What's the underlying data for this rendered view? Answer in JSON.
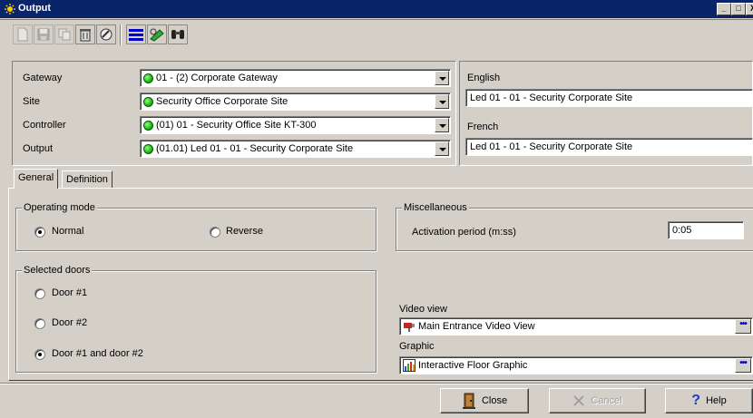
{
  "window": {
    "title": "Output",
    "controls": [
      "_",
      "□",
      "X"
    ]
  },
  "toolbar": {
    "buttons": [
      {
        "icon": "new-icon",
        "enabled": false
      },
      {
        "icon": "save-icon",
        "enabled": false
      },
      {
        "icon": "copy-icon",
        "enabled": false
      },
      {
        "icon": "delete-icon",
        "enabled": true
      },
      {
        "icon": "link-icon",
        "enabled": true
      },
      {
        "icon": "list-icon",
        "enabled": true
      },
      {
        "icon": "edit-link-icon",
        "enabled": true
      },
      {
        "icon": "binoculars-icon",
        "enabled": true
      }
    ]
  },
  "selection": {
    "gateway_label": "Gateway",
    "gateway_value": "01 - (2)  Corporate Gateway",
    "site_label": "Site",
    "site_value": "Security Office Corporate Site",
    "controller_label": "Controller",
    "controller_value": "(01) 01 - Security Office Site KT-300",
    "output_label": "Output",
    "output_value": "(01.01) Led 01 - 01 - Security Corporate Site"
  },
  "descriptions": {
    "english_label": "English",
    "english_value": "Led 01 - 01 - Security Corporate Site",
    "french_label": "French",
    "french_value": "Led 01 - 01 - Security Corporate Site"
  },
  "tabs": [
    {
      "label": "General",
      "active": true
    },
    {
      "label": "Definition",
      "active": false
    }
  ],
  "operating_mode": {
    "title": "Operating mode",
    "normal_label": "Normal",
    "reverse_label": "Reverse",
    "selected": "Normal"
  },
  "selected_doors": {
    "title": "Selected doors",
    "door1_label": "Door #1",
    "door2_label": "Door #2",
    "both_label": "Door #1 and door #2",
    "selected": "Door #1 and door #2"
  },
  "miscellaneous": {
    "title": "Miscellaneous",
    "activation_label": "Activation period (m:ss)",
    "activation_value": "0:05"
  },
  "video_view": {
    "label": "Video view",
    "value": "Main Entrance Video View"
  },
  "graphic": {
    "label": "Graphic",
    "value": "Interactive Floor Graphic"
  },
  "buttons": {
    "close": "Close",
    "cancel": "Cancel",
    "help": "Help"
  },
  "colors": {
    "titlebar": "#0a246a",
    "face": "#d4d0c8",
    "status_green": "#1fb814"
  }
}
